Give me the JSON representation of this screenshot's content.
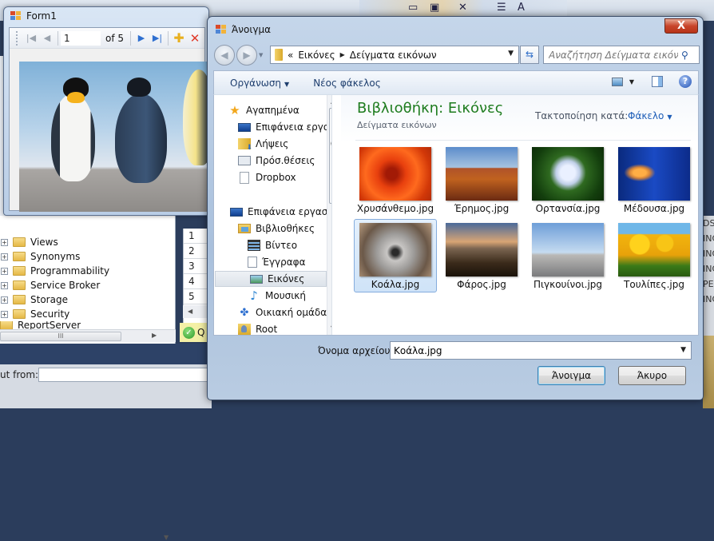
{
  "background_app": {
    "tree_items": [
      "Views",
      "Synonyms",
      "Programmability",
      "Service Broker",
      "Storage",
      "Security",
      "ReportServer"
    ],
    "grid_rows": [
      "1",
      "2",
      "3",
      "4",
      "5"
    ],
    "status_text": "Q",
    "bottom_label": "ut from:",
    "right_edge_text": [
      "DS",
      "INC",
      "INC",
      "INC",
      "PE",
      "INC"
    ]
  },
  "form1": {
    "title": "Form1",
    "navigator": {
      "position": "1",
      "count_label": "of 5",
      "buttons": [
        "move-first",
        "move-previous",
        "move-next",
        "move-last",
        "add-new",
        "delete"
      ]
    },
    "picture": "Penguins"
  },
  "dialog": {
    "title": "Άνοιγμα",
    "close_label": "X",
    "address": {
      "overflow": "«",
      "crumbs": [
        "Εικόνες",
        "Δείγματα εικόνων"
      ]
    },
    "search_placeholder": "Αναζήτηση Δείγματα εικόνων",
    "toolbar": {
      "organize": "Οργάνωση",
      "new_folder": "Νέος φάκελος"
    },
    "nav": {
      "favorites": "Αγαπημένα",
      "fav_items": [
        "Επιφάνεια εργασ",
        "Λήψεις",
        "Πρόσ.θέσεις",
        "Dropbox"
      ],
      "desktop": "Επιφάνεια εργασία",
      "libraries": "Βιβλιοθήκες",
      "lib_items": [
        "Βίντεο",
        "Έγγραφα",
        "Εικόνες",
        "Μουσική"
      ],
      "homegroup": "Οικιακή ομάδα",
      "root": "Root",
      "selected": "Εικόνες"
    },
    "content": {
      "library_title": "Βιβλιοθήκη: Εικόνες",
      "library_subtitle": "Δείγματα εικόνων",
      "arrange_label": "Τακτοποίηση κατά:",
      "arrange_value": "Φάκελο",
      "files": [
        {
          "name": "Χρυσάνθεμο.jpg",
          "thumb": "chrysanthemum"
        },
        {
          "name": "Έρημος.jpg",
          "thumb": "desert"
        },
        {
          "name": "Ορτανσία.jpg",
          "thumb": "hydrangea"
        },
        {
          "name": "Μέδουσα.jpg",
          "thumb": "jellyfish"
        },
        {
          "name": "Κοάλα.jpg",
          "thumb": "koala"
        },
        {
          "name": "Φάρος.jpg",
          "thumb": "lighthouse"
        },
        {
          "name": "Πιγκουίνοι.jpg",
          "thumb": "penguins"
        },
        {
          "name": "Τουλίπες.jpg",
          "thumb": "tulips"
        }
      ],
      "selected_file": "Κοάλα.jpg"
    },
    "footer": {
      "filename_label": "Όνομα αρχείου:",
      "filename_value": "Κοάλα.jpg",
      "open_label": "Άνοιγμα",
      "cancel_label": "Άκυρο"
    }
  }
}
